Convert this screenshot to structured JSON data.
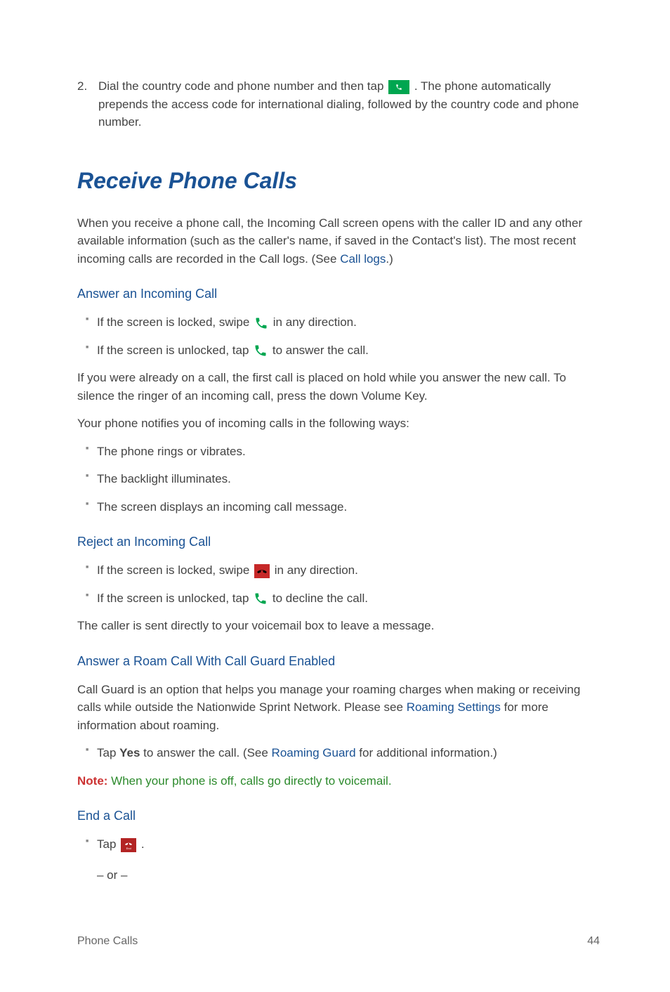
{
  "step2": {
    "number": "2.",
    "text_before": "Dial the country code and phone number and then tap ",
    "text_after": ". The phone automatically prepends the access code for international dialing, followed by the country code and phone number."
  },
  "heading_main": "Receive Phone Calls",
  "intro": {
    "text_before": "When you receive a phone call, the Incoming Call screen opens with the caller ID and any other available information (such as the caller's name, if saved in the Contact's list). The most recent incoming calls are recorded in the Call logs. (See ",
    "link": "Call logs",
    "text_after": ".)"
  },
  "answer": {
    "heading": "Answer an Incoming Call",
    "b1_before": "If the screen is locked, swipe ",
    "b1_after": " in any direction.",
    "b2_before": "If the screen is unlocked, tap ",
    "b2_after": " to answer the call.",
    "p1": "If you were already on a call, the first call is placed on hold while you answer the new call. To silence the ringer of an incoming call, press the down Volume Key.",
    "p2": "Your phone notifies you of incoming calls in the following ways:",
    "ways": {
      "w1": "The phone rings or vibrates.",
      "w2": "The backlight illuminates.",
      "w3": "The screen displays an incoming call message."
    }
  },
  "reject": {
    "heading": "Reject an Incoming Call",
    "b1_before": "If the screen is locked, swipe ",
    "b1_after": " in any direction.",
    "b2_before": "If the screen is unlocked, tap ",
    "b2_after": " to decline the call.",
    "p1": "The caller is sent directly to your voicemail box to leave a message."
  },
  "roam": {
    "heading": "Answer a Roam Call With Call Guard Enabled",
    "p_before": "Call Guard is an option that helps you manage your roaming charges when making or receiving calls while outside the Nationwide Sprint Network. Please see ",
    "link1": "Roaming Settings",
    "p_after": " for more information about roaming.",
    "b_before": "Tap ",
    "b_bold": "Yes",
    "b_mid": " to answer the call. (See ",
    "link2": "Roaming Guard",
    "b_after": " for additional information.)"
  },
  "note": {
    "label": "Note:",
    "text": "  When your phone is off, calls go directly to voicemail."
  },
  "endcall": {
    "heading": "End a Call",
    "tap": "Tap ",
    "period": ".",
    "end_label": "End",
    "or": "– or –"
  },
  "footer": {
    "left": "Phone Calls",
    "right": "44"
  }
}
